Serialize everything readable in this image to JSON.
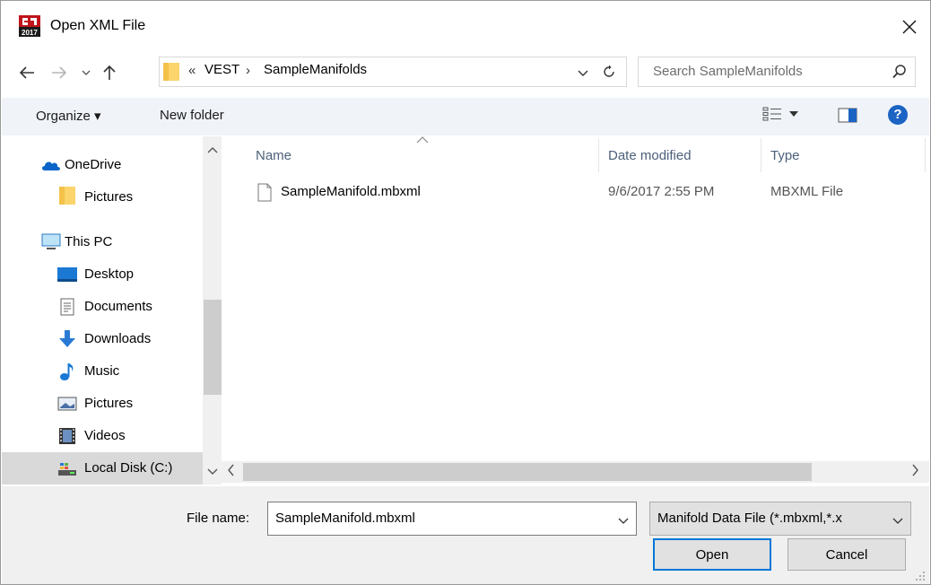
{
  "window": {
    "title": "Open XML File",
    "close_glyph": "✕"
  },
  "address": {
    "overflow": "«",
    "parts": [
      "VEST",
      "SampleManifolds"
    ],
    "separator": "›",
    "search_placeholder": "Search SampleManifolds"
  },
  "toolbar": {
    "organize_label": "Organize ▾",
    "new_folder_label": "New folder",
    "help_label": "?"
  },
  "nav": {
    "items": [
      {
        "label": "OneDrive",
        "icon": "onedrive-icon"
      },
      {
        "label": "Pictures",
        "icon": "folder-icon"
      },
      {
        "label": "This PC",
        "icon": "computer-icon"
      },
      {
        "label": "Desktop",
        "icon": "desktop-icon"
      },
      {
        "label": "Documents",
        "icon": "documents-icon"
      },
      {
        "label": "Downloads",
        "icon": "downloads-icon"
      },
      {
        "label": "Music",
        "icon": "music-icon"
      },
      {
        "label": "Pictures",
        "icon": "pictures-icon"
      },
      {
        "label": "Videos",
        "icon": "videos-icon"
      },
      {
        "label": "Local Disk (C:)",
        "icon": "local-disk-icon"
      }
    ]
  },
  "files": {
    "columns": [
      "Name",
      "Date modified",
      "Type"
    ],
    "rows": [
      {
        "name": "SampleManifold.mbxml",
        "date": "9/6/2017 2:55 PM",
        "type": "MBXML File"
      }
    ]
  },
  "bottom": {
    "file_name_label": "File name:",
    "file_name_value": "SampleManifold.mbxml",
    "file_type_value": "Manifold Data File (*.mbxml,*.x",
    "open_label": "Open",
    "cancel_label": "Cancel"
  },
  "colors": {
    "accent": "#0078d7",
    "toolbar_bg": "#f0f4f9",
    "header_text": "#4c607a"
  }
}
